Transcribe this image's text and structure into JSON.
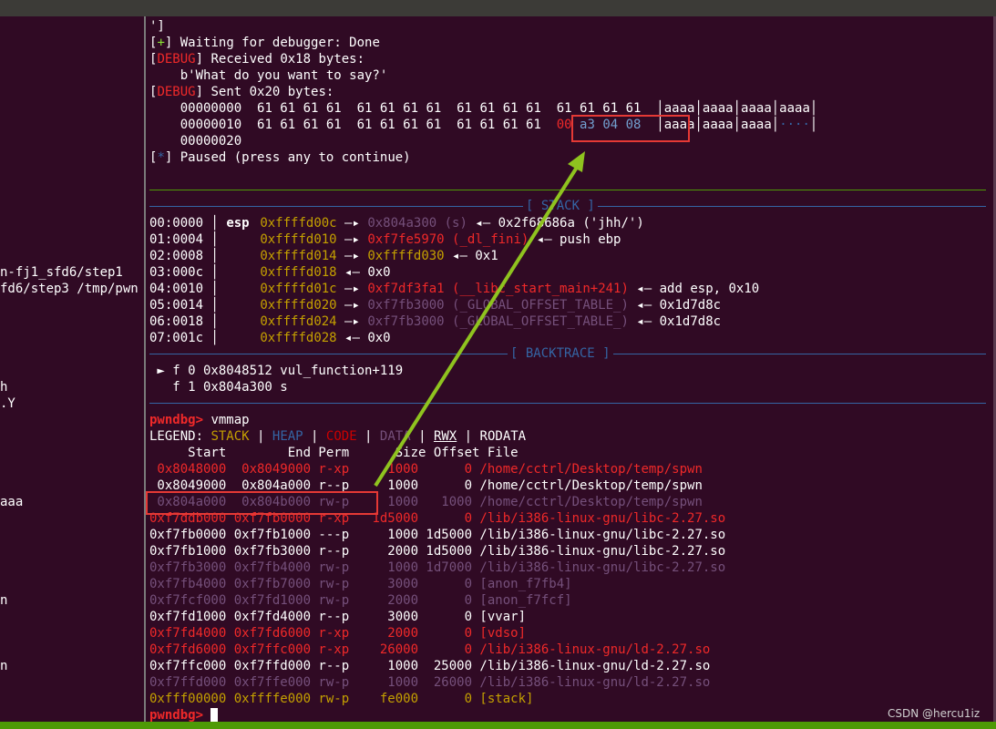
{
  "left_pane": {
    "lines": [
      {
        "text": "n-fj1_sfd6/step1",
        "row": 16
      },
      {
        "text": "fd6/step3 /tmp/pwn",
        "row": 17
      },
      {
        "text": "h",
        "row": 23
      },
      {
        "text": ".Y",
        "row": 24
      },
      {
        "text": "aaa",
        "row": 30
      },
      {
        "text": "n",
        "row": 36
      },
      {
        "text": "n",
        "row": 40
      }
    ]
  },
  "debug_log": {
    "line1": "']",
    "waiting_bracket_l": "[",
    "waiting_plus": "+",
    "waiting_bracket_r": "]",
    "waiting_text": " Waiting for debugger: Done",
    "debug_tag": "DEBUG",
    "received_text": " Received 0x18 bytes:",
    "received_payload": "    b'What do you want to say?'",
    "sent_text": " Sent 0x20 bytes:",
    "hex_row1_offset": "    00000000  ",
    "hex_row1_bytes": "61 61 61 61  61 61 61 61  61 61 61 61  61 61 61 61",
    "hex_row1_ascii": "  │aaaa│aaaa│aaaa│aaaa│",
    "hex_row2_offset": "    00000010  ",
    "hex_row2_bytes": "61 61 61 61  61 61 61 61  61 61 61 61  ",
    "hex_row2_b1": "00",
    "hex_row2_b2": " a3 04 08",
    "hex_row2_ascii_a": "  │aaaa│aaaa│aaaa│",
    "hex_row2_ascii_b": "····",
    "hex_row2_ascii_c": "│",
    "hex_row3_offset": "    00000020",
    "paused_star": "*",
    "paused_text": " Paused (press any to continue)"
  },
  "stack": {
    "title": "[ STACK ]",
    "rows": [
      {
        "idx": "00:0000",
        "reg": "esp",
        "addr": "0xffffd00c",
        "arrow1": " —▸ ",
        "val": "0x804a300 (s)",
        "rest": " ◂— 0x2f68686a ('jhh/')"
      },
      {
        "idx": "01:0004",
        "reg": "",
        "addr": "0xffffd010",
        "arrow1": " —▸ ",
        "val": "0xf7fe5970 (_dl_fini)",
        "rest": " ◂— push ebp"
      },
      {
        "idx": "02:0008",
        "reg": "",
        "addr": "0xffffd014",
        "arrow1": " —▸ ",
        "val": "0xffffd030",
        "rest": " ◂— 0x1"
      },
      {
        "idx": "03:000c",
        "reg": "",
        "addr": "0xffffd018",
        "arrow1": " ◂— ",
        "val": "0x0",
        "rest": ""
      },
      {
        "idx": "04:0010",
        "reg": "",
        "addr": "0xffffd01c",
        "arrow1": " —▸ ",
        "val": "0xf7df3fa1 (__libc_start_main+241)",
        "rest": " ◂— add esp, 0x10"
      },
      {
        "idx": "05:0014",
        "reg": "",
        "addr": "0xffffd020",
        "arrow1": " —▸ ",
        "val": "0xf7fb3000 (_GLOBAL_OFFSET_TABLE_)",
        "rest": " ◂— 0x1d7d8c"
      },
      {
        "idx": "06:0018",
        "reg": "",
        "addr": "0xffffd024",
        "arrow1": " —▸ ",
        "val": "0xf7fb3000 (_GLOBAL_OFFSET_TABLE_)",
        "rest": " ◂— 0x1d7d8c"
      },
      {
        "idx": "07:001c",
        "reg": "",
        "addr": "0xffffd028",
        "arrow1": " ◂— ",
        "val": "0x0",
        "rest": ""
      }
    ]
  },
  "backtrace": {
    "title": "[ BACKTRACE ]",
    "frame0": " ► f 0 0x8048512 vul_function+119",
    "frame1": "   f 1 0x804a300 s"
  },
  "vmmap": {
    "prompt": "pwndbg>",
    "command": " vmmap",
    "legend_label": "LEGEND: ",
    "legend_stack": "STACK",
    "legend_heap": "HEAP",
    "legend_code": "CODE",
    "legend_data": "DATA",
    "legend_rwx": "RWX",
    "legend_rodata": "RODATA",
    "legend_sep": " | ",
    "header": "     Start        End Perm      Size Offset File",
    "rows": [
      {
        "text": " 0x8048000  0x8049000 r-xp     1000      0 /home/cctrl/Desktop/temp/spwn",
        "kind": "code"
      },
      {
        "text": " 0x8049000  0x804a000 r--p     1000      0 /home/cctrl/Desktop/temp/spwn",
        "kind": "rodata"
      },
      {
        "text": " 0x804a000  0x804b000 rw-p     1000   1000 /home/cctrl/Desktop/temp/spwn",
        "kind": "data"
      },
      {
        "text": "0xf7ddb000 0xf7fb0000 r-xp   1d5000      0 /lib/i386-linux-gnu/libc-2.27.so",
        "kind": "code"
      },
      {
        "text": "0xf7fb0000 0xf7fb1000 ---p     1000 1d5000 /lib/i386-linux-gnu/libc-2.27.so",
        "kind": "rodata"
      },
      {
        "text": "0xf7fb1000 0xf7fb3000 r--p     2000 1d5000 /lib/i386-linux-gnu/libc-2.27.so",
        "kind": "rodata"
      },
      {
        "text": "0xf7fb3000 0xf7fb4000 rw-p     1000 1d7000 /lib/i386-linux-gnu/libc-2.27.so",
        "kind": "data"
      },
      {
        "text": "0xf7fb4000 0xf7fb7000 rw-p     3000      0 [anon_f7fb4]",
        "kind": "data"
      },
      {
        "text": "0xf7fcf000 0xf7fd1000 rw-p     2000      0 [anon_f7fcf]",
        "kind": "data"
      },
      {
        "text": "0xf7fd1000 0xf7fd4000 r--p     3000      0 [vvar]",
        "kind": "rodata"
      },
      {
        "text": "0xf7fd4000 0xf7fd6000 r-xp     2000      0 [vdso]",
        "kind": "code"
      },
      {
        "text": "0xf7fd6000 0xf7ffc000 r-xp    26000      0 /lib/i386-linux-gnu/ld-2.27.so",
        "kind": "code"
      },
      {
        "text": "0xf7ffc000 0xf7ffd000 r--p     1000  25000 /lib/i386-linux-gnu/ld-2.27.so",
        "kind": "rodata"
      },
      {
        "text": "0xf7ffd000 0xf7ffe000 rw-p     1000  26000 /lib/i386-linux-gnu/ld-2.27.so",
        "kind": "data"
      },
      {
        "text": "0xfff00000 0xffffe000 rw-p    fe000      0 [stack]",
        "kind": "stack"
      }
    ],
    "final_prompt": "pwndbg>"
  },
  "colors": {
    "background": "#300a24",
    "annotation_box": "#e53935",
    "annotation_arrow": "#8fc31f",
    "status_bar": "#4e9a06"
  },
  "watermark": "CSDN @hercu1iz"
}
